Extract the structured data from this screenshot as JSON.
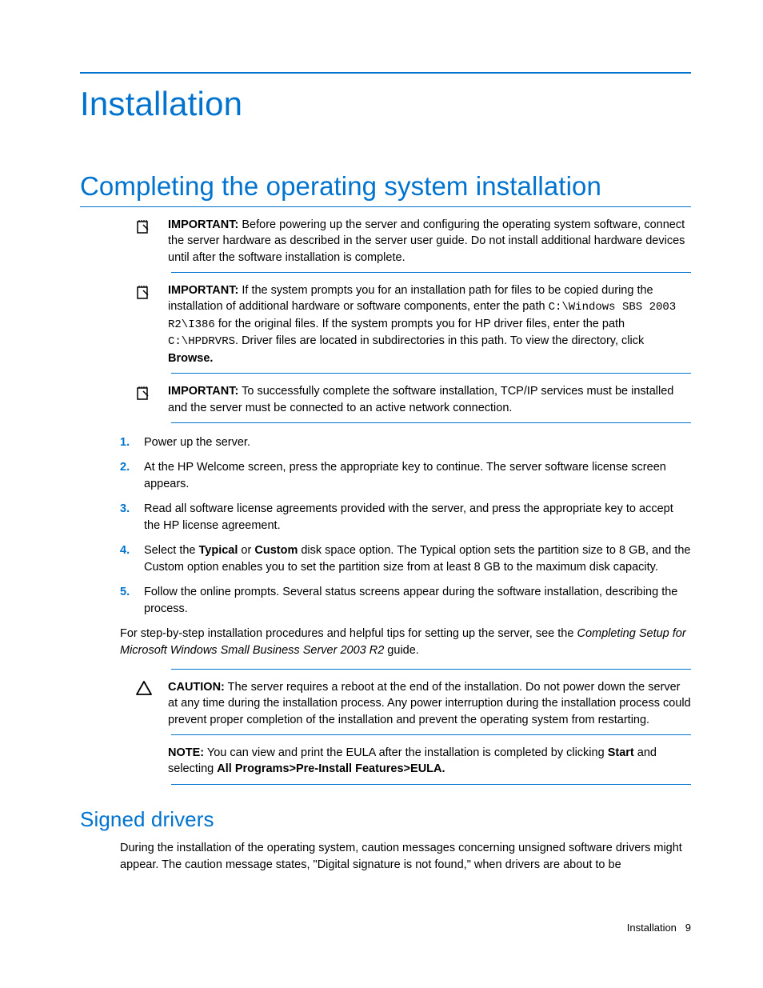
{
  "title": "Installation",
  "section1": {
    "heading": "Completing the operating system installation",
    "admon1": {
      "label": "IMPORTANT:",
      "text": "  Before powering up the server and configuring the operating system software, connect the server hardware as described in the server user guide. Do not install additional hardware devices until after the software installation is complete."
    },
    "admon2": {
      "label": "IMPORTANT:",
      "text_a": "  If the system prompts you for an installation path for files to be copied during the installation of additional hardware or software components, enter the path ",
      "code_a": "C:\\Windows SBS 2003 R2\\I386",
      "text_b": " for the original files. If the system prompts you for HP driver files, enter the path ",
      "code_b": "C:\\HPDRVRS",
      "text_c": ". Driver files are located in subdirectories in this path. To view the directory, click ",
      "bold_a": "Browse."
    },
    "admon3": {
      "label": "IMPORTANT:",
      "text": "  To successfully complete the software installation, TCP/IP services must be installed and the server must be connected to an active network connection."
    },
    "steps": [
      {
        "n": "1.",
        "t": "Power up the server."
      },
      {
        "n": "2.",
        "t": "At the HP Welcome screen, press the appropriate key to continue. The server software license screen appears."
      },
      {
        "n": "3.",
        "t": "Read all software license agreements provided with the server, and press the appropriate key to accept the HP license agreement."
      },
      {
        "n": "4.",
        "t_a": "Select the ",
        "b_a": "Typical",
        "t_b": " or ",
        "b_b": "Custom",
        "t_c": " disk space option. The Typical option sets the partition size to 8 GB, and the Custom option enables you to set the partition size from at least 8 GB to the maximum disk capacity."
      },
      {
        "n": "5.",
        "t": "Follow the online prompts. Several status screens appear during the software installation, describing the process."
      }
    ],
    "after_steps_a": "For step-by-step installation procedures and helpful tips for setting up the server, see the ",
    "after_steps_italic": "Completing Setup for Microsoft Windows Small Business Server 2003 R2",
    "after_steps_b": " guide.",
    "caution": {
      "label": "CAUTION:",
      "text": "  The server requires a reboot at the end of the installation. Do not power down the server at any time during the installation process. Any power interruption during the installation process could prevent proper completion of the installation and prevent the operating system from restarting."
    },
    "note": {
      "label": "NOTE:",
      "text_a": "  You can view and print the EULA after the installation is completed by clicking ",
      "bold_a": "Start",
      "text_b": " and selecting ",
      "bold_b": "All Programs>Pre-Install Features>EULA."
    }
  },
  "section2": {
    "heading": "Signed drivers",
    "para": "During the installation of the operating system, caution messages concerning unsigned software drivers might appear. The caution message states, \"Digital signature is not found,\" when drivers are about to be"
  },
  "footer": {
    "section": "Installation",
    "page": "9"
  }
}
